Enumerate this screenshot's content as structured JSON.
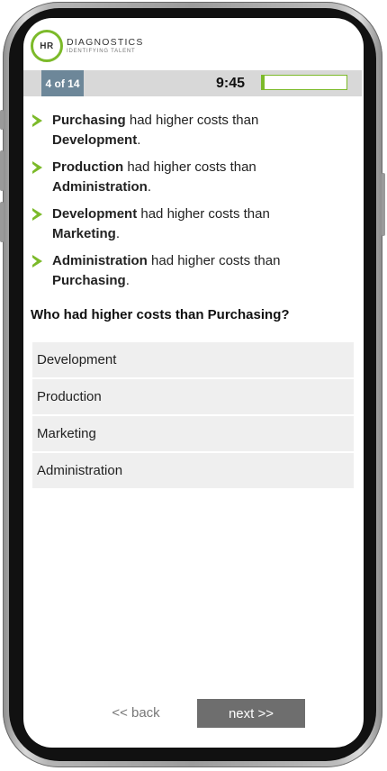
{
  "brand": {
    "mark": "HR",
    "name": "DIAGNOSTICS",
    "tagline": "IDENTIFYING TALENT",
    "accent_color": "#7cba2a"
  },
  "status": {
    "progress": "4 of 14",
    "timer": "9:45",
    "time_remaining_fraction": 0.03
  },
  "statements": [
    {
      "a": "Purchasing",
      "middle": " had higher costs than ",
      "b": "Development",
      "end": "."
    },
    {
      "a": "Production",
      "middle": " had higher costs than ",
      "b": "Administration",
      "end": "."
    },
    {
      "a": "Development",
      "middle": " had higher costs than ",
      "b": "Marketing",
      "end": "."
    },
    {
      "a": "Administration",
      "middle": " had higher costs than ",
      "b": "Purchasing",
      "end": "."
    }
  ],
  "question": "Who had higher costs than Purchasing?",
  "options": [
    "Development",
    "Production",
    "Marketing",
    "Administration"
  ],
  "nav": {
    "back_label": "<< back",
    "next_label": "next >>"
  }
}
